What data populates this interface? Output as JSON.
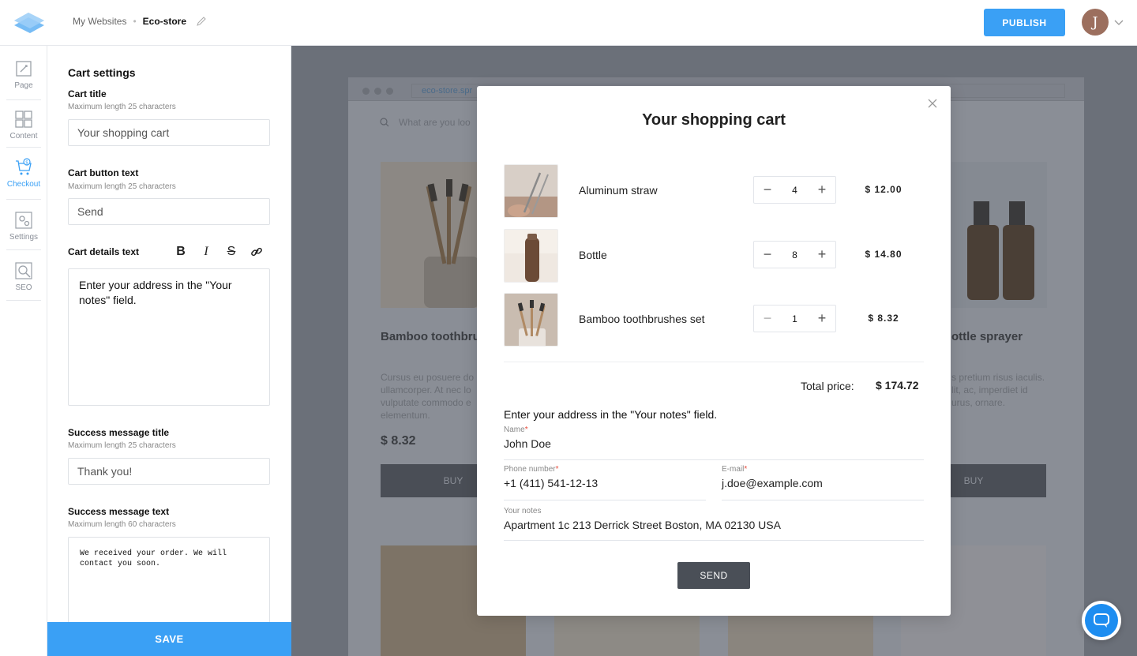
{
  "header": {
    "breadcrumb_root": "My Websites",
    "breadcrumb_separator": "•",
    "breadcrumb_current": "Eco-store",
    "publish_label": "PUBLISH",
    "avatar_initial": "J",
    "brand_color": "#3aa0f5"
  },
  "rail": {
    "items": [
      {
        "label": "Page",
        "icon": "page-icon"
      },
      {
        "label": "Content",
        "icon": "grid-icon"
      },
      {
        "label": "Checkout",
        "icon": "cart-icon",
        "active": true
      },
      {
        "label": "Settings",
        "icon": "gear-icon"
      },
      {
        "label": "SEO",
        "icon": "seo-icon"
      }
    ]
  },
  "panel": {
    "title": "Cart settings",
    "cart_title": {
      "label": "Cart title",
      "hint": "Maximum length 25 characters",
      "value": "Your shopping cart"
    },
    "cart_button": {
      "label": "Cart button text",
      "hint": "Maximum length 25 characters",
      "value": "Send"
    },
    "cart_details": {
      "label": "Cart details text",
      "value": "Enter your address in the \"Your notes\" field."
    },
    "success_title": {
      "label": "Success message title",
      "hint": "Maximum length 25 characters",
      "value": "Thank you!"
    },
    "success_text": {
      "label": "Success message text",
      "hint": "Maximum length 60 characters",
      "value": "We received your order. We will contact you soon."
    },
    "save_label": "SAVE"
  },
  "preview": {
    "url": "eco-store.spr",
    "search_placeholder": "What are you loo",
    "product1": {
      "title": "Bamboo toothbru",
      "desc": "Cursus eu posuere do ullamcorper. At nec lo vulputate commodo e elementum.",
      "price": "$ 8.32",
      "buy": "BUY"
    },
    "product2": {
      "title": "ottle sprayer",
      "desc": "s pretium risus iaculis. lit, ac, imperdiet id urus, ornare.",
      "buy": "BUY"
    }
  },
  "modal": {
    "title": "Your shopping cart",
    "items": [
      {
        "name": "Aluminum straw",
        "qty": "4",
        "price": "$ 12.00"
      },
      {
        "name": "Bottle",
        "qty": "8",
        "price": "$ 14.80"
      },
      {
        "name": "Bamboo toothbrushes set",
        "qty": "1",
        "price": "$ 8.32"
      }
    ],
    "total_label": "Total price:",
    "total_value": "$ 174.72",
    "note": "Enter your address in the \"Your notes\" field.",
    "fields": {
      "name": {
        "label": "Name",
        "value": "John Doe",
        "required": "*"
      },
      "phone": {
        "label": "Phone number",
        "value": "+1 (411) 541-12-13",
        "required": "*"
      },
      "email": {
        "label": "E-mail",
        "value": "j.doe@example.com",
        "required": "*"
      },
      "notes": {
        "label": "Your notes",
        "value": "Apartment 1c 213 Derrick Street Boston, MA 02130 USA"
      }
    },
    "send_label": "SEND"
  }
}
